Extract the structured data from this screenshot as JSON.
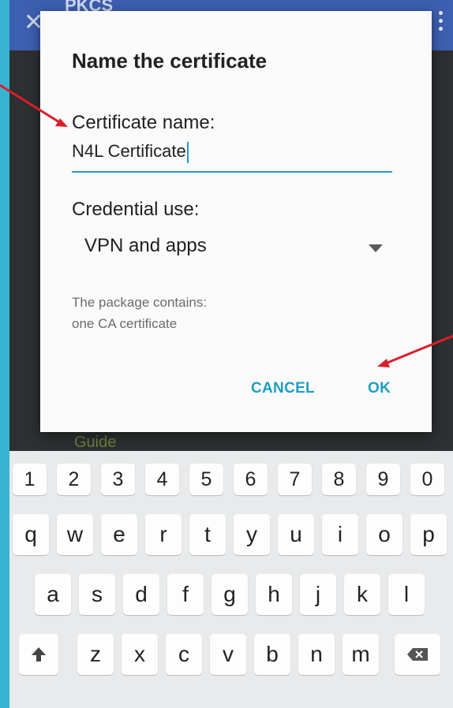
{
  "appbar": {
    "title": "PKCS",
    "close_icon": "close-icon",
    "menu_icon": "overflow-menu-icon"
  },
  "background_text": {
    "guide": "Guide"
  },
  "dialog": {
    "title": "Name the certificate",
    "name_label": "Certificate name:",
    "name_value": "N4L Certificate",
    "use_label": "Credential use:",
    "use_value": "VPN and apps",
    "package_line1": "The package contains:",
    "package_line2": "one CA certificate",
    "cancel_label": "CANCEL",
    "ok_label": "OK"
  },
  "keyboard": {
    "numbers": [
      "1",
      "2",
      "3",
      "4",
      "5",
      "6",
      "7",
      "8",
      "9",
      "0"
    ],
    "row1": [
      "q",
      "w",
      "e",
      "r",
      "t",
      "y",
      "u",
      "i",
      "o",
      "p"
    ],
    "row2": [
      "a",
      "s",
      "d",
      "f",
      "g",
      "h",
      "j",
      "k",
      "l"
    ],
    "row3": [
      "z",
      "x",
      "c",
      "v",
      "b",
      "n",
      "m"
    ],
    "shift_icon": "shift-arrow-icon",
    "backspace_icon": "backspace-icon"
  },
  "colors": {
    "accent": "#1f9ec1",
    "annotation": "#d9202b",
    "appbar": "#3c5fb0",
    "frame": "#39b3d2"
  }
}
